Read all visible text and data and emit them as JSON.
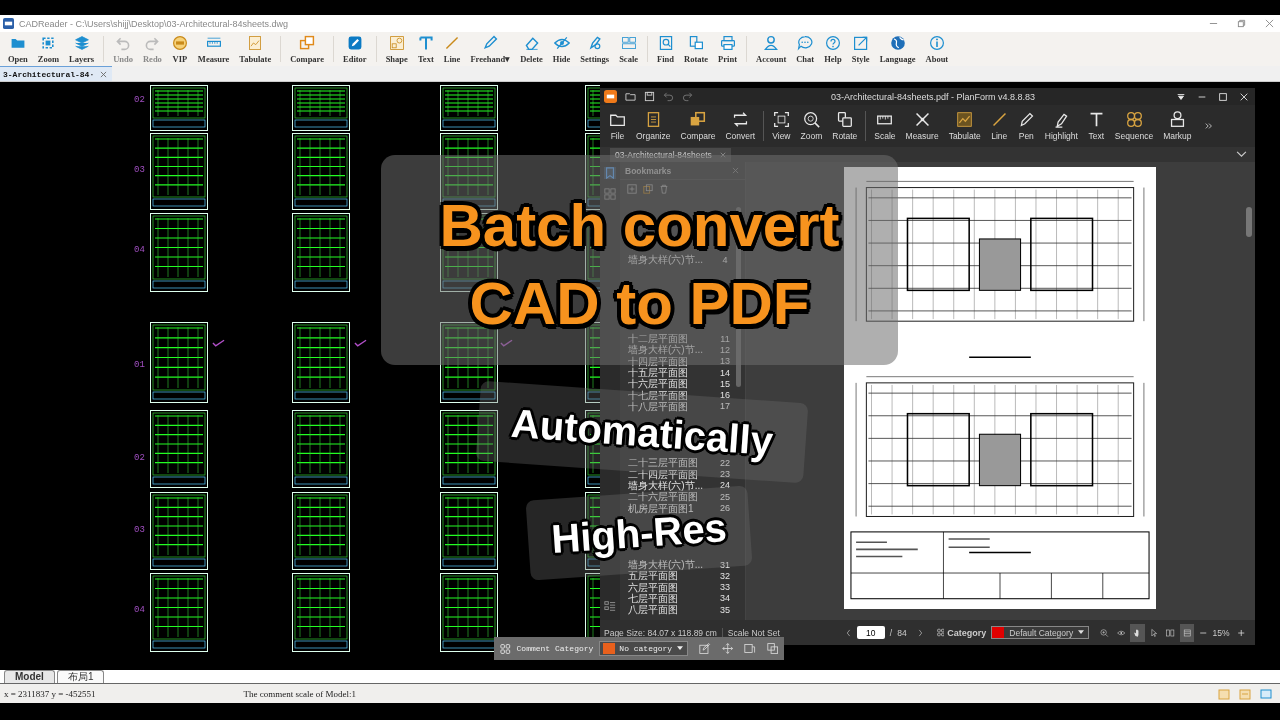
{
  "cad_window": {
    "title": "CADReader - C:\\Users\\shijj\\Desktop\\03-Architectural-84sheets.dwg",
    "toolbar": [
      [
        {
          "label": "Open",
          "disabled": false
        },
        {
          "label": "Zoom",
          "disabled": false
        },
        {
          "label": "Layers",
          "disabled": false
        }
      ],
      [
        {
          "label": "Undo",
          "disabled": true
        },
        {
          "label": "Redo",
          "disabled": true
        },
        {
          "label": "VIP",
          "disabled": false
        },
        {
          "label": "Measure",
          "disabled": false
        },
        {
          "label": "Tabulate",
          "disabled": false
        }
      ],
      [
        {
          "label": "Compare",
          "disabled": false
        }
      ],
      [
        {
          "label": "Editor",
          "disabled": false
        }
      ],
      [
        {
          "label": "Shape",
          "disabled": false
        },
        {
          "label": "Text",
          "disabled": false
        },
        {
          "label": "Line",
          "disabled": false
        },
        {
          "label": "Freehand▾",
          "disabled": false
        },
        {
          "label": "Delete",
          "disabled": false
        },
        {
          "label": "Hide",
          "disabled": false
        },
        {
          "label": "Settings",
          "disabled": false
        },
        {
          "label": "Scale",
          "disabled": false
        }
      ],
      [
        {
          "label": "Find",
          "disabled": false
        },
        {
          "label": "Rotate",
          "disabled": false
        },
        {
          "label": "Print",
          "disabled": false
        }
      ],
      [
        {
          "label": "Account",
          "disabled": false
        },
        {
          "label": "Chat",
          "disabled": false
        },
        {
          "label": "Help",
          "disabled": false
        },
        {
          "label": "Style",
          "disabled": false
        },
        {
          "label": "Language",
          "disabled": false
        },
        {
          "label": "About",
          "disabled": false
        }
      ]
    ],
    "tabs": [
      {
        "label": "3-Architectural-84·",
        "selected": true
      }
    ],
    "sheet_labels": {
      "upper": [
        "02",
        "03",
        "04"
      ],
      "lower": [
        "01",
        "02",
        "03",
        "04"
      ]
    },
    "layout_tabs": [
      {
        "label": "Model",
        "selected": true
      },
      {
        "label": "布局1",
        "selected": false
      }
    ],
    "status_bar": {
      "coordinates": "x = 2311837 y = -452551",
      "comment_scale": "The comment scale of Model:1"
    }
  },
  "pdf_window": {
    "title": "03-Architectural-84sheets.pdf - PlanForm v4.8.8.83",
    "toolbar": [
      [
        "File",
        "Organize",
        "Compare",
        "Convert"
      ],
      [
        "View",
        "Zoom",
        "Rotate"
      ],
      [
        "Scale",
        "Measure",
        "Tabulate",
        "Line",
        "Pen",
        "Highlight",
        "Text",
        "Sequence",
        "Markup"
      ]
    ],
    "tab": "03-Architectural-84sheets",
    "bookmarks": {
      "title": "Bookmarks",
      "items": [
        {
          "label": "墙身大样(六)节...",
          "page": "4"
        },
        {
          "label": "十二层平面图",
          "page": "11"
        },
        {
          "label": "墙身大样(六)节...",
          "page": "12"
        },
        {
          "label": "十四层平面图",
          "page": "13"
        },
        {
          "label": "十五层平面图",
          "page": "14"
        },
        {
          "label": "十六层平面图",
          "page": "15"
        },
        {
          "label": "十七层平面图",
          "page": "16"
        },
        {
          "label": "十八层平面图",
          "page": "17"
        },
        {
          "label": "二十三层平面图",
          "page": "22"
        },
        {
          "label": "二十四层平面图",
          "page": "23"
        },
        {
          "label": "墙身大样(六)节...",
          "page": "24"
        },
        {
          "label": "二十六层平面图",
          "page": "25"
        },
        {
          "label": "机房层平面图1",
          "page": "26"
        },
        {
          "label": "墙身大样(六)节...",
          "page": "31"
        },
        {
          "label": "五层平面图",
          "page": "32"
        },
        {
          "label": "六层平面图",
          "page": "33"
        },
        {
          "label": "七层平面图",
          "page": "34"
        },
        {
          "label": "八层平面图",
          "page": "35"
        }
      ]
    },
    "bottom_bar": {
      "page_size": "Page Size: 84.07 x 118.89 cm",
      "scale": "Scale Not Set",
      "page": "10",
      "page_of": "/",
      "page_total": "84",
      "category_label": "Category",
      "category": "Default Category",
      "zoom": "15%"
    },
    "comment_bar": {
      "label": "Comment Category",
      "category": "No category"
    }
  },
  "overlay": {
    "headline": [
      "Batch convert",
      "CAD to PDF"
    ],
    "badges": [
      "Automatically",
      "High-Res"
    ]
  }
}
